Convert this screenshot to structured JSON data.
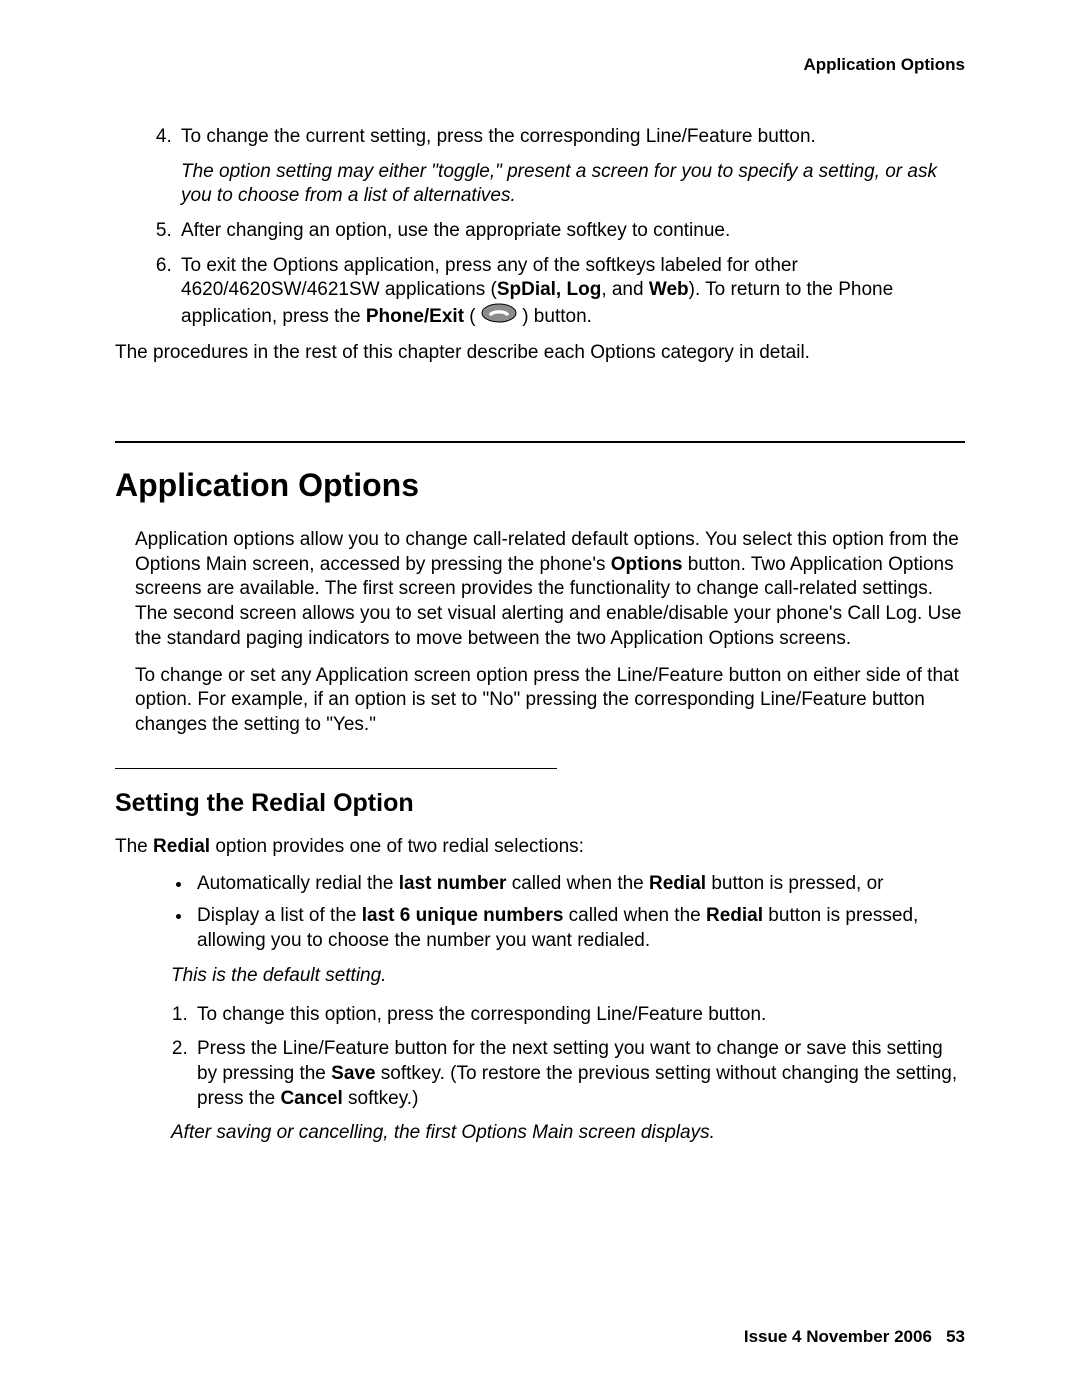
{
  "header": {
    "title": "Application Options"
  },
  "topList": {
    "item4": "To change the current setting, press the corresponding Line/Feature button.",
    "item4_note": "The option setting may either \"toggle,\" present a screen for you to specify a setting, or ask you to choose from a list of alternatives.",
    "item5": "After changing an option, use the appropriate softkey to continue.",
    "item6_a": "To exit the Options application, press any of the softkeys labeled for other 4620/4620SW/4621SW applications (",
    "item6_b": "SpDial, Log",
    "item6_c": ", and ",
    "item6_d": "Web",
    "item6_e": "). To return to the Phone application, press the ",
    "item6_f": "Phone/Exit",
    "item6_g": " ( ",
    "item6_h": " ) button."
  },
  "afterList": "The procedures in the rest of this chapter describe each Options category in detail.",
  "h1": "Application Options",
  "appOptions": {
    "para1_a": "Application options allow you to change call-related default options. You select this option from the Options Main screen, accessed by pressing the phone's ",
    "para1_b": "Options",
    "para1_c": " button. Two Application Options screens are available. The first screen provides the functionality to change call-related settings. The second screen allows you to set visual alerting and enable/disable your phone's Call Log. Use the standard paging indicators to move between the two Application Options screens.",
    "para2": "To change or set any Application screen option press the Line/Feature button on either side of that option. For example, if an option is set to \"No\" pressing the corresponding Line/Feature button changes the setting to \"Yes.\""
  },
  "h2": "Setting the Redial Option",
  "redial": {
    "intro_a": "The ",
    "intro_b": "Redial",
    "intro_c": " option provides one of two redial selections:",
    "bullet1_a": "Automatically redial the ",
    "bullet1_b": "last number",
    "bullet1_c": " called when the ",
    "bullet1_d": "Redial",
    "bullet1_e": " button is pressed, or",
    "bullet2_a": "Display a list of the ",
    "bullet2_b": "last 6 unique numbers",
    "bullet2_c": " called when the ",
    "bullet2_d": "Redial",
    "bullet2_e": " button is pressed, allowing you to choose the number you want redialed.",
    "default_note": "This is the default setting.",
    "step1": "To change this option, press the corresponding Line/Feature button.",
    "step2_a": "Press the Line/Feature button for the next setting you want to change or save this setting by pressing the ",
    "step2_b": "Save",
    "step2_c": " softkey. (To restore the previous setting without changing the setting, press the ",
    "step2_d": "Cancel",
    "step2_e": " softkey.)",
    "after_note": "After saving or cancelling, the first Options Main screen displays."
  },
  "footer": {
    "issue": "Issue 4   November 2006",
    "page": "53"
  }
}
